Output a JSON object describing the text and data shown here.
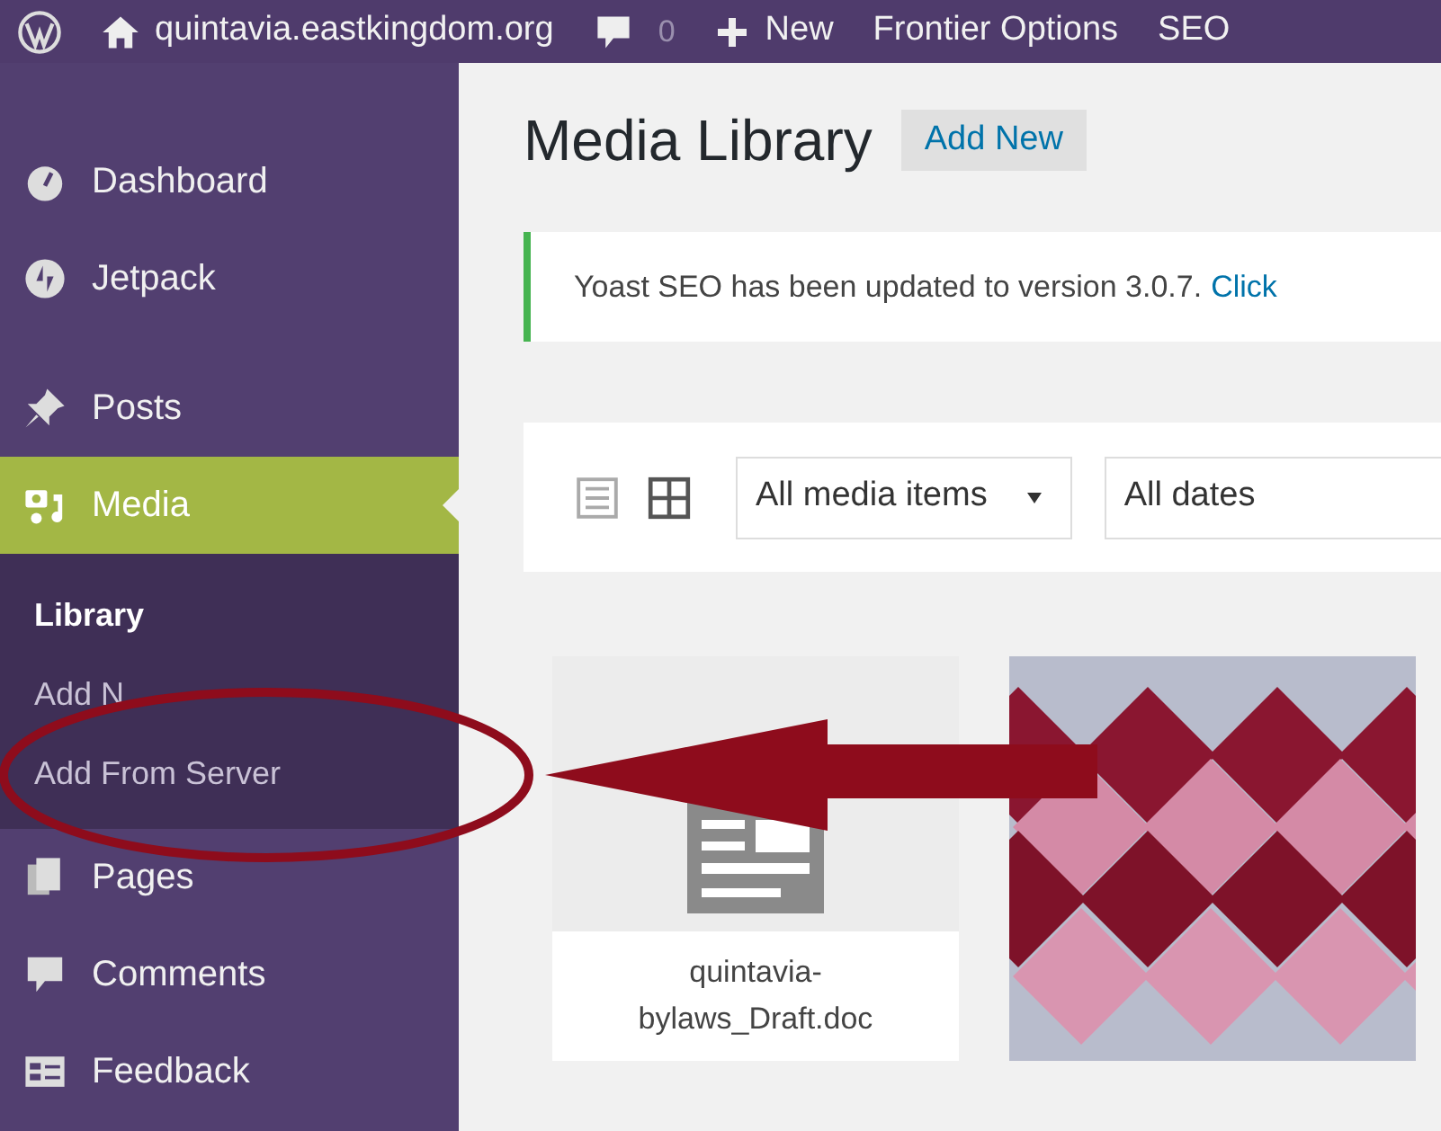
{
  "admin_bar": {
    "items": [
      {
        "kind": "logo"
      },
      {
        "kind": "site",
        "label": "quintavia.eastkingdom.org"
      },
      {
        "kind": "comments",
        "label": "0"
      },
      {
        "kind": "new",
        "label": "New"
      },
      {
        "kind": "text",
        "label": "Frontier Options"
      },
      {
        "kind": "text",
        "label": "SEO"
      }
    ]
  },
  "sidebar": {
    "items": [
      {
        "kind": "item",
        "label": "Dashboard",
        "selected": false
      },
      {
        "kind": "item",
        "label": "Jetpack",
        "selected": false
      },
      {
        "kind": "separator"
      },
      {
        "kind": "item",
        "label": "Posts",
        "selected": false
      },
      {
        "kind": "item",
        "label": "Media",
        "selected": true,
        "children": [
          {
            "label": "Library",
            "selected": true
          },
          {
            "label": "Add N",
            "selected": false
          },
          {
            "label": "Add From Server",
            "selected": false
          }
        ]
      },
      {
        "kind": "item",
        "label": "Pages",
        "selected": false
      },
      {
        "kind": "item",
        "label": "Comments",
        "selected": false
      },
      {
        "kind": "item",
        "label": "Feedback",
        "selected": false
      }
    ]
  },
  "page": {
    "title": "Media Library",
    "add_new_button": "Add New",
    "notice": {
      "text": "Yoast SEO has been updated to version 3.0.7.",
      "link": "Click"
    },
    "view_modes": [
      {
        "kind": "list",
        "selected": false
      },
      {
        "kind": "grid",
        "selected": true
      }
    ],
    "filters": [
      {
        "value": "All media items",
        "caret": true
      },
      {
        "value": "All dates",
        "caret": false
      }
    ],
    "media_items": [
      {
        "kind": "document",
        "filename": "quintavia-bylaws_Draft.doc"
      },
      {
        "kind": "picture"
      }
    ]
  }
}
